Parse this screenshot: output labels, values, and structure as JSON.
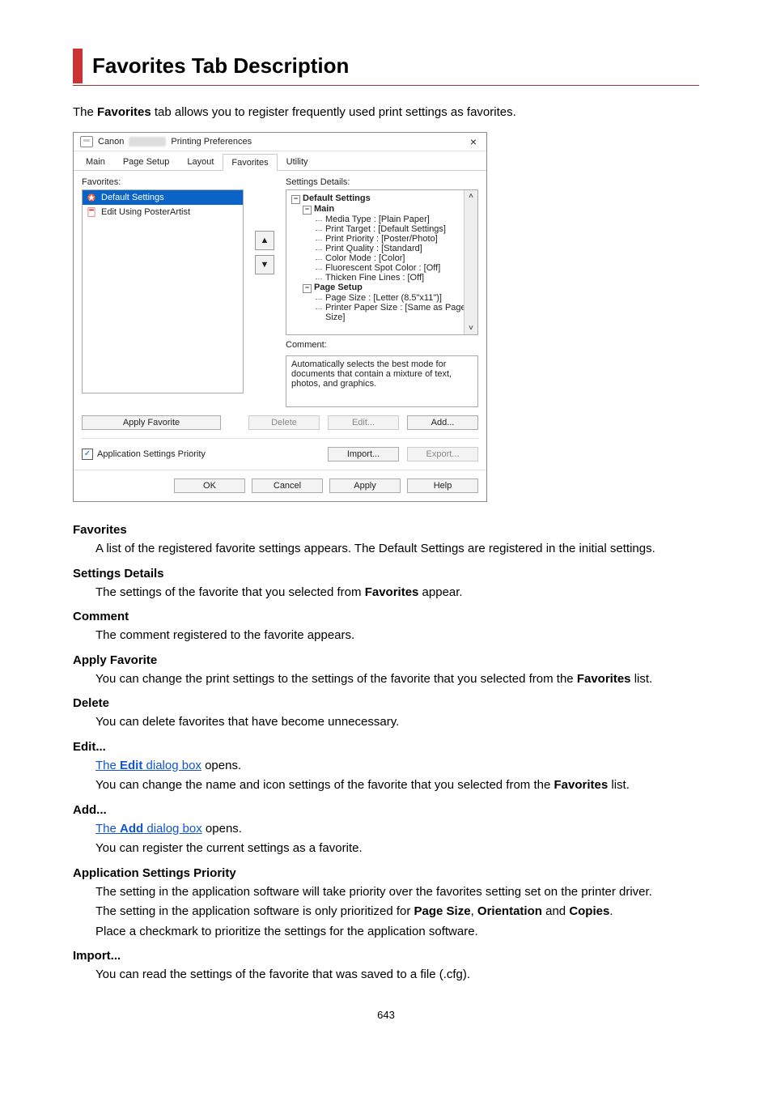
{
  "heading": "Favorites Tab Description",
  "intro": {
    "pre": "The ",
    "bold": "Favorites",
    "post": " tab allows you to register frequently used print settings as favorites."
  },
  "dialog": {
    "brand": "Canon",
    "title_suffix": "Printing Preferences",
    "tabs": [
      "Main",
      "Page Setup",
      "Layout",
      "Favorites",
      "Utility"
    ],
    "active_tab": 3,
    "favorites_label": "Favorites:",
    "favorites_items": [
      {
        "label": "Default Settings",
        "selected": true,
        "icon": "star"
      },
      {
        "label": "Edit Using PosterArtist",
        "selected": false,
        "icon": "doc"
      }
    ],
    "settings_label": "Settings Details:",
    "tree": {
      "root": "Default Settings",
      "group1": "Main",
      "group2": "Page Setup",
      "leaves1": [
        "Media Type : [Plain Paper]",
        "Print Target : [Default Settings]",
        "Print Priority : [Poster/Photo]",
        "Print Quality : [Standard]",
        "Color Mode : [Color]",
        "Fluorescent Spot Color : [Off]",
        "Thicken Fine Lines : [Off]"
      ],
      "leaves2": [
        "Page Size : [Letter (8.5\"x11\")]",
        "Printer Paper Size : [Same as Page Size]"
      ]
    },
    "comment_label": "Comment:",
    "comment_text": "Automatically selects the best mode for documents that contain a mixture of text, photos, and graphics.",
    "buttons": {
      "apply_favorite": "Apply Favorite",
      "delete": "Delete",
      "edit": "Edit...",
      "add": "Add...",
      "import": "Import...",
      "export": "Export..."
    },
    "checkbox_label": "Application Settings Priority",
    "footer": {
      "ok": "OK",
      "cancel": "Cancel",
      "apply": "Apply",
      "help": "Help"
    }
  },
  "defs": {
    "favorites": {
      "term": "Favorites",
      "body": "A list of the registered favorite settings appears. The Default Settings are registered in the initial settings."
    },
    "settings_details": {
      "term": "Settings Details",
      "before": "The settings of the favorite that you selected from ",
      "bold": "Favorites",
      "after": " appear."
    },
    "comment": {
      "term": "Comment",
      "body": "The comment registered to the favorite appears."
    },
    "apply_favorite": {
      "term": "Apply Favorite",
      "before": "You can change the print settings to the settings of the favorite that you selected from the ",
      "bold": "Favorites",
      "after": " list."
    },
    "delete": {
      "term": "Delete",
      "body": "You can delete favorites that have become unnecessary."
    },
    "edit": {
      "term": "Edit...",
      "link_pre": "The ",
      "link_bold": "Edit",
      "link_post": " dialog box",
      "after_link": " opens.",
      "line2_before": "You can change the name and icon settings of the favorite that you selected from the ",
      "line2_bold": "Favorites",
      "line2_after": " list."
    },
    "add": {
      "term": "Add...",
      "link_pre": "The ",
      "link_bold": "Add",
      "link_post": " dialog box",
      "after_link": " opens.",
      "line2": "You can register the current settings as a favorite."
    },
    "app_priority": {
      "term": "Application Settings Priority",
      "line1": "The setting in the application software will take priority over the favorites setting set on the printer driver.",
      "line2_before": "The setting in the application software is only prioritized for ",
      "b1": "Page Size",
      "sep1": ", ",
      "b2": "Orientation",
      "sep2": " and ",
      "b3": "Copies",
      "end": ".",
      "line3": "Place a checkmark to prioritize the settings for the application software."
    },
    "import": {
      "term": "Import...",
      "body": "You can read the settings of the favorite that was saved to a file (.cfg)."
    }
  },
  "page_number": "643"
}
